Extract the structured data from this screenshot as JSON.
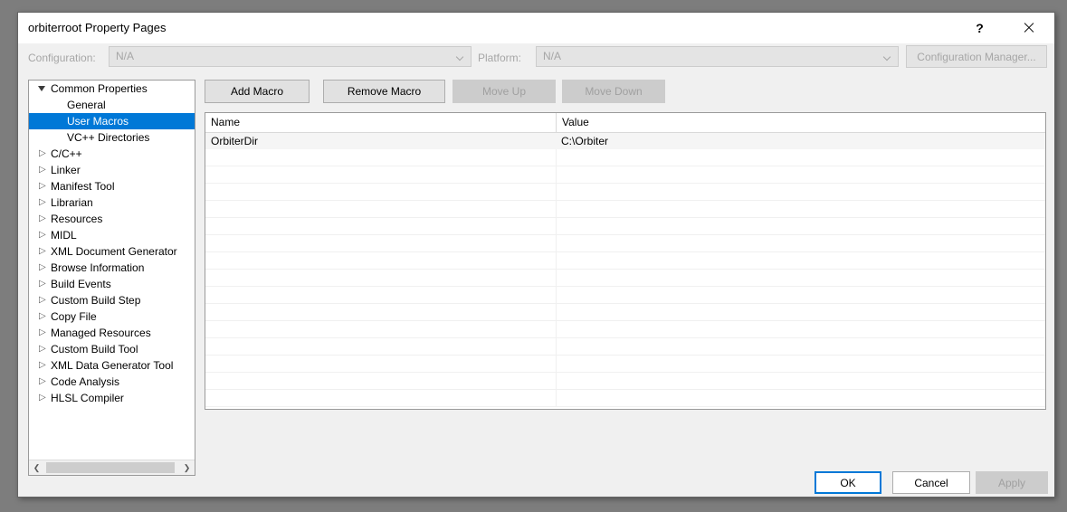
{
  "window": {
    "title": "orbiterroot Property Pages",
    "help_icon": "question-mark-icon",
    "close_icon": "close-icon"
  },
  "config_bar": {
    "configuration_label": "Configuration:",
    "configuration_value": "N/A",
    "platform_label": "Platform:",
    "platform_value": "N/A",
    "configuration_manager_label": "Configuration Manager..."
  },
  "tree": {
    "items": [
      {
        "label": "Common Properties",
        "level": 0,
        "state": "expanded",
        "selected": false
      },
      {
        "label": "General",
        "level": 1,
        "state": "leaf",
        "selected": false
      },
      {
        "label": "User Macros",
        "level": 1,
        "state": "leaf",
        "selected": true
      },
      {
        "label": "VC++ Directories",
        "level": 1,
        "state": "leaf",
        "selected": false
      },
      {
        "label": "C/C++",
        "level": 0,
        "state": "collapsed",
        "selected": false
      },
      {
        "label": "Linker",
        "level": 0,
        "state": "collapsed",
        "selected": false
      },
      {
        "label": "Manifest Tool",
        "level": 0,
        "state": "collapsed",
        "selected": false
      },
      {
        "label": "Librarian",
        "level": 0,
        "state": "collapsed",
        "selected": false
      },
      {
        "label": "Resources",
        "level": 0,
        "state": "collapsed",
        "selected": false
      },
      {
        "label": "MIDL",
        "level": 0,
        "state": "collapsed",
        "selected": false
      },
      {
        "label": "XML Document Generator",
        "level": 0,
        "state": "collapsed",
        "selected": false
      },
      {
        "label": "Browse Information",
        "level": 0,
        "state": "collapsed",
        "selected": false
      },
      {
        "label": "Build Events",
        "level": 0,
        "state": "collapsed",
        "selected": false
      },
      {
        "label": "Custom Build Step",
        "level": 0,
        "state": "collapsed",
        "selected": false
      },
      {
        "label": "Copy File",
        "level": 0,
        "state": "collapsed",
        "selected": false
      },
      {
        "label": "Managed Resources",
        "level": 0,
        "state": "collapsed",
        "selected": false
      },
      {
        "label": "Custom Build Tool",
        "level": 0,
        "state": "collapsed",
        "selected": false
      },
      {
        "label": "XML Data Generator Tool",
        "level": 0,
        "state": "collapsed",
        "selected": false
      },
      {
        "label": "Code Analysis",
        "level": 0,
        "state": "collapsed",
        "selected": false
      },
      {
        "label": "HLSL Compiler",
        "level": 0,
        "state": "collapsed",
        "selected": false
      }
    ],
    "scrollbar": {
      "left_arrow_icon": "chevron-left-icon",
      "right_arrow_icon": "chevron-right-icon"
    }
  },
  "toolbar": {
    "add_macro_label": "Add Macro",
    "remove_macro_label": "Remove Macro",
    "move_up_label": "Move Up",
    "move_down_label": "Move Down",
    "move_up_enabled": false,
    "move_down_enabled": false
  },
  "macros_list": {
    "columns": [
      "Name",
      "Value"
    ],
    "rows": [
      {
        "name": "OrbiterDir",
        "value": "C:\\Orbiter"
      }
    ],
    "empty_row_count": 15
  },
  "footer": {
    "ok_label": "OK",
    "cancel_label": "Cancel",
    "apply_label": "Apply",
    "apply_enabled": false
  },
  "colors": {
    "selection_blue": "#0078d7",
    "dialog_background": "#f0f0f0",
    "disabled_text": "#a0a0a0",
    "desktop_background": "#7d7d7d"
  }
}
